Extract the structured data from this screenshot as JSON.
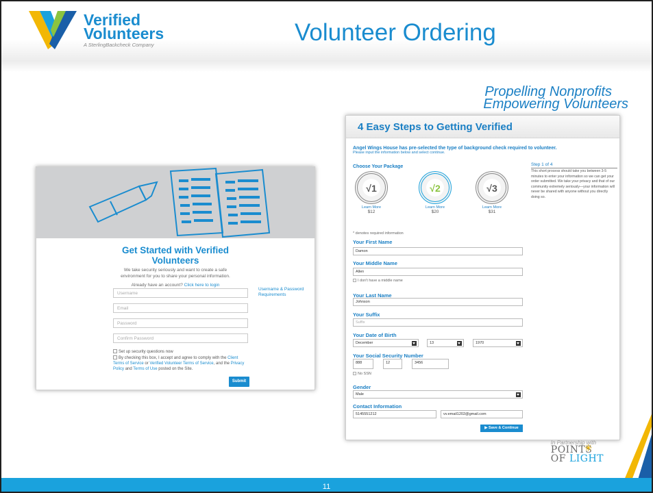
{
  "slide": {
    "title": "Volunteer Ordering",
    "tagline_line1": "Propelling Nonprofits",
    "tagline_line2": "Empowering Volunteers",
    "page_number": "11"
  },
  "logo": {
    "word1": "Verified",
    "word2": "Volunteers",
    "tagline": "A SterlingBackcheck Company"
  },
  "partner": {
    "prefix": "In Partnership with",
    "name_line1": "POINTS",
    "name_line2_a": "OF ",
    "name_line2_b": "LIGHT"
  },
  "left_screen": {
    "title": "Get Started with Verified Volunteers",
    "description": "We take security seriously and want to create a safe environment for you to share your personal information.",
    "login_prompt": "Already have an account?",
    "login_link": "Click here to login",
    "fields": {
      "username": "Username",
      "email": "Email",
      "password": "Password",
      "confirm_password": "Confirm Password"
    },
    "requirements_link": "Username & Password Requirements",
    "security_checkbox": "Set up security questions now",
    "agree_prefix": "By checking this box, I accept and agree to comply with the",
    "link_client_terms": "Client Terms of Service",
    "or_text": "or",
    "link_vv_terms": "Verified Volunteer Terms of Service",
    "and_the": ", and the",
    "link_privacy": "Privacy Policy",
    "and_text": "and",
    "link_terms_use": "Terms of Use",
    "posted": "posted on the Site.",
    "submit": "Submit"
  },
  "right_screen": {
    "title": "4 Easy Steps to Getting Verified",
    "intro": "Angel Wings House has pre-selected the type of background check required to volunteer.",
    "intro_sub": "Please input the information below and select continue.",
    "package_label": "Choose Your Package",
    "packages": [
      {
        "level": "1",
        "learn_more": "Learn More",
        "price": "$12",
        "selected": false
      },
      {
        "level": "2",
        "learn_more": "Learn More",
        "price": "$20",
        "selected": true
      },
      {
        "level": "3",
        "learn_more": "Learn More",
        "price": "$31",
        "selected": false
      }
    ],
    "step_label": "Step 1 of 4",
    "step_text": "This short process should take you between 3-5 minutes to enter your information so we can get your order submitted. We take your privacy and that of our community extremely seriously—your information will never be shared with anyone without you directly doing so.",
    "required_note": "* denotes required information",
    "first_name_label": "Your First Name",
    "first_name": "Damon",
    "middle_name_label": "Your Middle Name",
    "middle_name": "Allen",
    "no_middle": "I don't have a middle name",
    "last_name_label": "Your Last Name",
    "last_name": "Johnson",
    "suffix_label": "Your Suffix",
    "suffix_placeholder": "Suffix",
    "dob_label": "Your Date of Birth",
    "dob_month": "December",
    "dob_day": "13",
    "dob_year": "1970",
    "ssn_label": "Your Social Security Number",
    "ssn_1": "888",
    "ssn_2": "12",
    "ssn_3": "3456",
    "no_ssn": "No SSN",
    "gender_label": "Gender",
    "gender": "Male",
    "contact_label": "Contact Information",
    "phone": "5145551212",
    "email": "vv.email1202@gmail.com",
    "save_button": "Save & Continue"
  },
  "colors": {
    "brand_blue": "#1a8ccf",
    "footer_blue": "#1aa2dd",
    "accent_yellow": "#f2b705",
    "accent_green": "#8bc43f"
  }
}
